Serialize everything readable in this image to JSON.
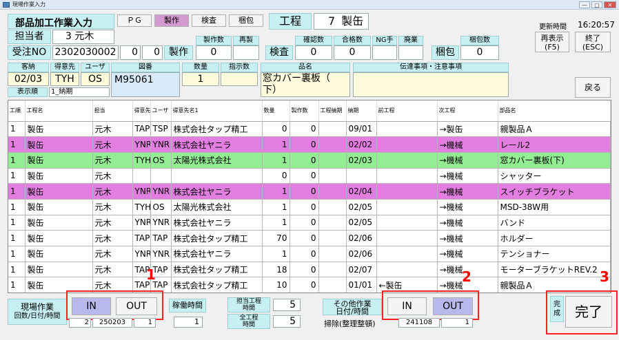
{
  "window": {
    "title": "現場作業入力",
    "controls": [
      "—",
      "▢",
      "✕"
    ]
  },
  "header": {
    "screen_title": "部品加工作業入力",
    "tabs": [
      "ＰＧ",
      "製作",
      "検査",
      "梱包"
    ],
    "process_label": "工程",
    "process_no": "7",
    "process_name": "製缶",
    "update_time_label": "更新時間",
    "update_time": "16:20:57",
    "refresh_label": "再表示",
    "refresh_key": "(F5)",
    "exit_label": "終了",
    "exit_key": "(ESC)"
  },
  "form": {
    "tantousha_label": "担当者",
    "tantousha_no": "3",
    "tantousha_name": "元木",
    "juchu_label": "受注NO",
    "juchu_no": "2302030002",
    "juchu_a": "0",
    "juchu_b": "0",
    "seisaku_label": "製作",
    "seisakusu_label": "製作数",
    "saisei_label": "再製",
    "seisakusu": "0",
    "kensa_label": "検査",
    "kakuninsu_label": "確認数",
    "goukakusu_label": "合格数",
    "ng_label": "NG手",
    "haiki_label": "廃業",
    "kakuninsu": "0",
    "goukakusu": "0",
    "konpo_label": "梱包",
    "konposu_label": "梱包数",
    "konposu": "0",
    "nouki_label": "客納",
    "nouki": "02/03",
    "tokuisaki_label": "得意先",
    "tokuisaki": "TYH",
    "user_label": "ユーザ",
    "user": "OS",
    "zuban_label": "図番",
    "zuban": "M95061",
    "suryo_label": "数量",
    "suryo": "1",
    "shijisu_label": "指示数",
    "hinmei_label": "品名",
    "hinmei_line1": "窓カバー裏板（",
    "hinmei_line2": "下）",
    "dentatsu_label": "伝達事項・注意事項",
    "hyojijun_label": "表示順",
    "hyojijun_value": "1_納期",
    "back_label": "戻る"
  },
  "table": {
    "headers": [
      "工順",
      "工程名",
      "担当",
      "得意先コード",
      "ユーザ",
      "得意先名1",
      "数量",
      "製作数",
      "工程納期",
      "納期",
      "前工程",
      "次工程",
      "部品名"
    ],
    "rows": [
      {
        "style": "white",
        "cells": [
          "1",
          "製缶",
          "元木",
          "TAP",
          "TSP",
          "株式会社タップ精工",
          "0",
          "0",
          "",
          "09/01",
          "",
          "→製缶",
          "親製品Ａ"
        ]
      },
      {
        "style": "pink",
        "cells": [
          "1",
          "製缶",
          "元木",
          "YNR",
          "YNR",
          "株式会社ヤニラ",
          "1",
          "0",
          "",
          "02/02",
          "",
          "→機械",
          "レール2"
        ]
      },
      {
        "style": "green",
        "cells": [
          "1",
          "製缶",
          "元木",
          "TYH",
          "OS",
          "太陽光株式会社",
          "1",
          "0",
          "",
          "02/03",
          "",
          "→機械",
          "窓カバー裏板(下)"
        ]
      },
      {
        "style": "white",
        "cells": [
          "1",
          "製缶",
          "元木",
          "",
          "",
          "",
          "0",
          "0",
          "",
          "",
          "",
          "→機械",
          "シャッター"
        ]
      },
      {
        "style": "pink",
        "cells": [
          "1",
          "製缶",
          "元木",
          "YNR",
          "YNR",
          "株式会社ヤニラ",
          "1",
          "0",
          "",
          "02/04",
          "",
          "→機械",
          "スイッチブラケット"
        ]
      },
      {
        "style": "white",
        "cells": [
          "1",
          "製缶",
          "元木",
          "TYH",
          "OS",
          "太陽光株式会社",
          "1",
          "0",
          "",
          "02/05",
          "",
          "→機械",
          "MSD-38W用"
        ]
      },
      {
        "style": "white",
        "cells": [
          "1",
          "製缶",
          "元木",
          "YNR",
          "YNR",
          "株式会社ヤニラ",
          "1",
          "0",
          "",
          "02/05",
          "",
          "→機械",
          "バンド"
        ]
      },
      {
        "style": "white",
        "cells": [
          "1",
          "製缶",
          "元木",
          "TAP",
          "TAP",
          "株式会社タップ精工",
          "70",
          "0",
          "",
          "02/06",
          "",
          "→機械",
          "ホルダー"
        ]
      },
      {
        "style": "white",
        "cells": [
          "1",
          "製缶",
          "元木",
          "YNR",
          "YNR",
          "株式会社ヤニラ",
          "1",
          "0",
          "",
          "02/06",
          "",
          "→機械",
          "テンショナー"
        ]
      },
      {
        "style": "white",
        "cells": [
          "1",
          "製缶",
          "元木",
          "TAP",
          "TAP",
          "株式会社タップ精工",
          "18",
          "0",
          "",
          "02/07",
          "",
          "→機械",
          "モーターブラケットREV.2"
        ]
      },
      {
        "style": "white",
        "cells": [
          "1",
          "製缶",
          "元木",
          "TAP",
          "TAP",
          "株式会社タップ精工",
          "10",
          "0",
          "",
          "01/01",
          "←製缶",
          "→機械",
          "親製品Ａ"
        ]
      }
    ]
  },
  "footer": {
    "genba_label1": "現場作業",
    "genba_label2": "回数/日付/時間",
    "in_label": "IN",
    "out_label": "OUT",
    "genba_count": "2",
    "genba_date": "250203",
    "genba_time": "1",
    "kado_label": "稼働時間",
    "kado_value": "1",
    "tanto_koutei_label1": "担当工程",
    "tanto_koutei_label2": "時間",
    "tanto_koutei_value": "5",
    "zen_koutei_label1": "全工程",
    "zen_koutei_label2": "時間",
    "zen_koutei_value": "5",
    "sonota_label1": "その他作業",
    "sonota_label2": "日付/時間",
    "sonota_in": "IN",
    "sonota_out": "OUT",
    "souji_label": "掃除(整理整頓)",
    "sonota_date": "241108",
    "sonota_time": "1",
    "kansei_small_1": "完",
    "kansei_small_2": "成",
    "kanryo_label": "完了"
  },
  "annotations": {
    "n1": "1",
    "n2": "2",
    "n3": "3"
  },
  "colors": {
    "pink_row": "#e27ee0",
    "green_row": "#93ee93",
    "label_cyan": "#c7f0f3",
    "annotation_red": "#ff0000",
    "in_active": "#b8b8ec"
  }
}
